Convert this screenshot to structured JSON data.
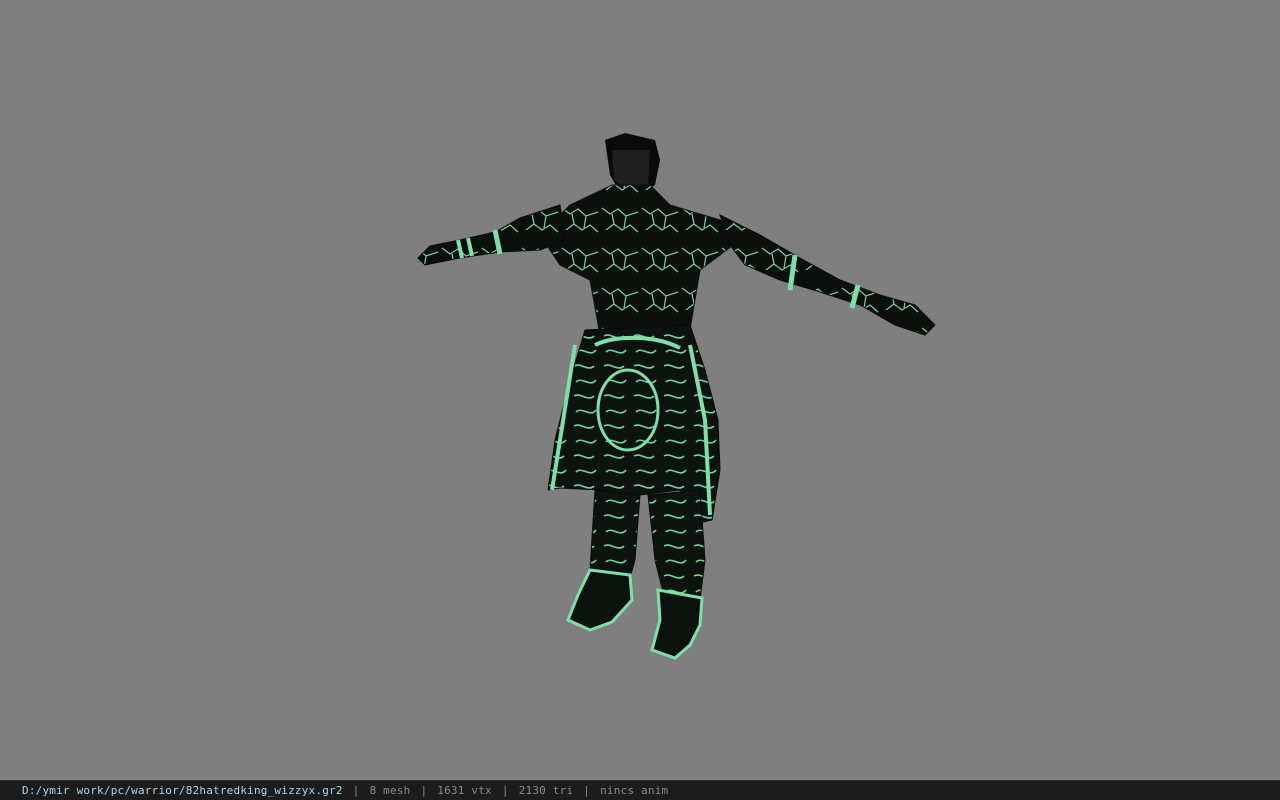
{
  "viewer": {
    "background_color": "#7f7f7f",
    "model_description_icon": "character-model-warrior"
  },
  "statusbar": {
    "file_path": "D:/ymir work/pc/warrior/82hatredking_wizzyx.gr2",
    "separator": "|",
    "mesh_count": "8 mesh",
    "vertex_count": "1631 vtx",
    "triangle_count": "2130 tri",
    "anim_status": "nincs anim",
    "path_color": "#a9d4ea",
    "text_color": "#8a8a8a",
    "background_color": "#1c1c1c"
  },
  "model": {
    "primary_color": "#0a0f0c",
    "glow_color": "#7ee0a8"
  }
}
